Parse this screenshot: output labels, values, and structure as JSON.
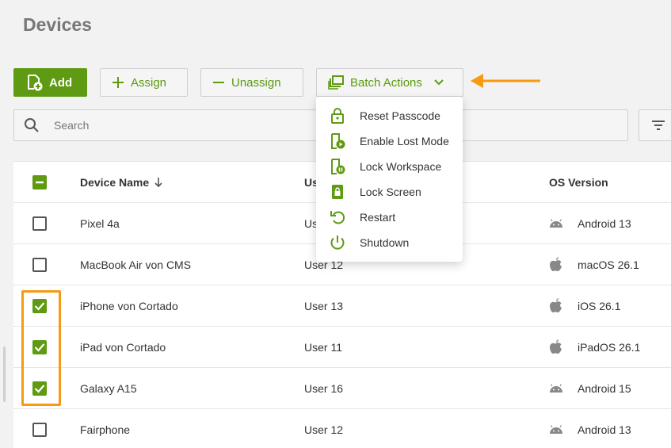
{
  "page": {
    "title": "Devices"
  },
  "toolbar": {
    "add_label": "Add",
    "assign_label": "Assign",
    "unassign_label": "Unassign",
    "batch_label": "Batch Actions"
  },
  "search": {
    "placeholder": "Search"
  },
  "batch_menu": {
    "items": [
      {
        "label": "Reset Passcode",
        "icon": "lock-icon"
      },
      {
        "label": "Enable Lost Mode",
        "icon": "lost-mode-icon"
      },
      {
        "label": "Lock Workspace",
        "icon": "lock-workspace-icon"
      },
      {
        "label": "Lock Screen",
        "icon": "lock-screen-icon"
      },
      {
        "label": "Restart",
        "icon": "restart-icon"
      },
      {
        "label": "Shutdown",
        "icon": "power-icon"
      }
    ]
  },
  "table": {
    "headers": {
      "name": "Device Name",
      "user": "Us",
      "os": "OS Version"
    },
    "select_all_state": "partial",
    "rows": [
      {
        "name": "Pixel 4a",
        "user": "Us",
        "os": "Android 13",
        "os_icon": "android-icon",
        "checked": false
      },
      {
        "name": "MacBook Air von CMS",
        "user": "User 12",
        "os": "macOS 26.1",
        "os_icon": "apple-icon",
        "checked": false
      },
      {
        "name": "iPhone von Cortado",
        "user": "User 13",
        "os": "iOS 26.1",
        "os_icon": "apple-icon",
        "checked": true
      },
      {
        "name": "iPad von Cortado",
        "user": "User 11",
        "os": "iPadOS 26.1",
        "os_icon": "apple-icon",
        "checked": true
      },
      {
        "name": "Galaxy A15",
        "user": "User 16",
        "os": "Android 15",
        "os_icon": "android-icon",
        "checked": true
      },
      {
        "name": "Fairphone",
        "user": "User 12",
        "os": "Android 13",
        "os_icon": "android-icon",
        "checked": false
      }
    ]
  },
  "colors": {
    "accent": "#5e9a12",
    "annotation": "#f59a12"
  }
}
